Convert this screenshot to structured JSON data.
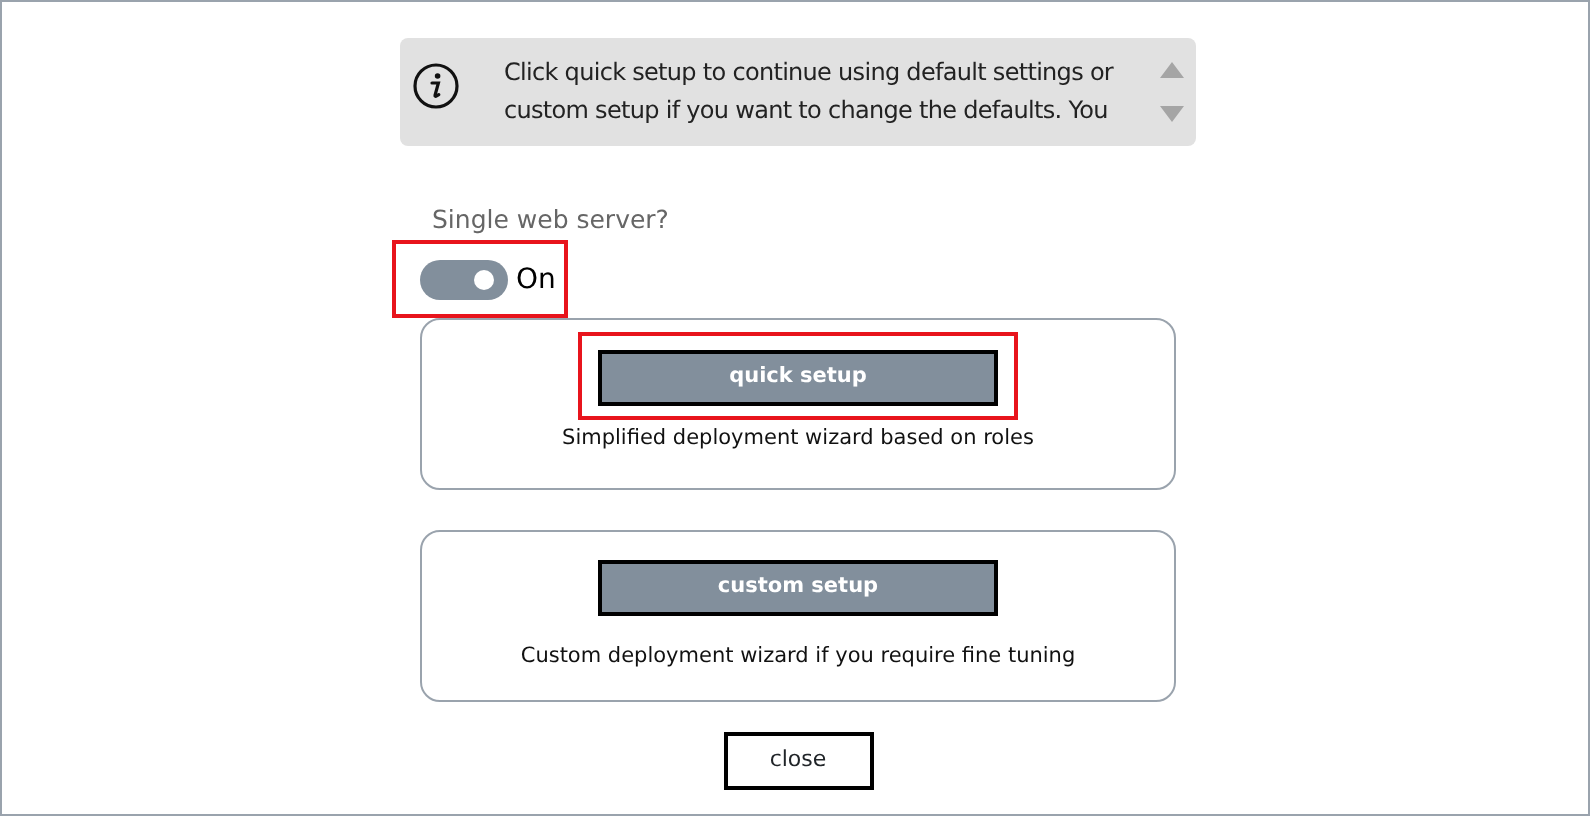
{
  "info": {
    "text": "Click quick setup to continue using default settings or custom setup if you want to change the defaults. You"
  },
  "toggle": {
    "label": "Single web server?",
    "on": true,
    "state_text": "On",
    "highlighted": true
  },
  "options": [
    {
      "button": "quick setup",
      "description": "Simplified deployment wizard based on roles",
      "highlighted": true
    },
    {
      "button": "custom setup",
      "description": "Custom deployment wizard if you require fine tuning",
      "highlighted": false
    }
  ],
  "close_button": "close"
}
